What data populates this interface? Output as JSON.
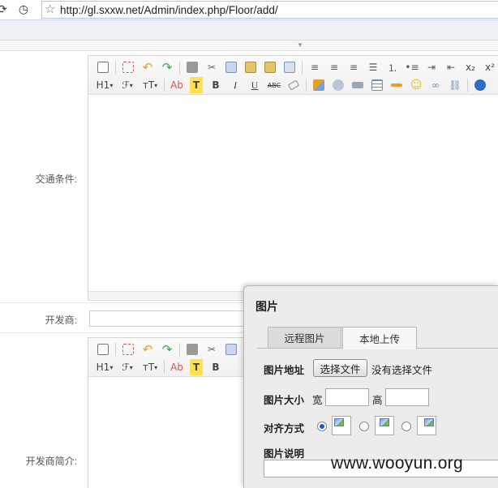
{
  "browser": {
    "url": "http://gl.sxxw.net/Admin/index.php/Floor/add/"
  },
  "form": {
    "traffic_label": "交通条件:",
    "developer_label": "开发商:",
    "developer_intro_label": "开发商简介:"
  },
  "editor_toolbar": {
    "heading": "H1",
    "font_family": "ℱ",
    "font_size": "тT",
    "forecolor_text": "Ab",
    "backcolor_text": "T",
    "bold": "B",
    "italic": "I",
    "underline": "U",
    "strike": "ABC",
    "subscript": "x₂",
    "superscript": "x²"
  },
  "image_dialog": {
    "title": "图片",
    "tab_remote": "远程图片",
    "tab_local": "本地上传",
    "address_label": "图片地址",
    "choose_file_button": "选择文件",
    "no_file_text": "没有选择文件",
    "size_label": "图片大小",
    "width_label": "宽",
    "height_label": "高",
    "align_label": "对齐方式",
    "align_selected": "left",
    "description_label": "图片说明"
  },
  "watermark": "www.wooyun.org",
  "colors": {
    "accent_blue": "#1f5fb8",
    "dialog_bg": "#ececec",
    "toolbar_icon_red": "#d9534f",
    "toolbar_icon_green": "#3aa64a",
    "toolbar_icon_orange": "#e8a020"
  }
}
